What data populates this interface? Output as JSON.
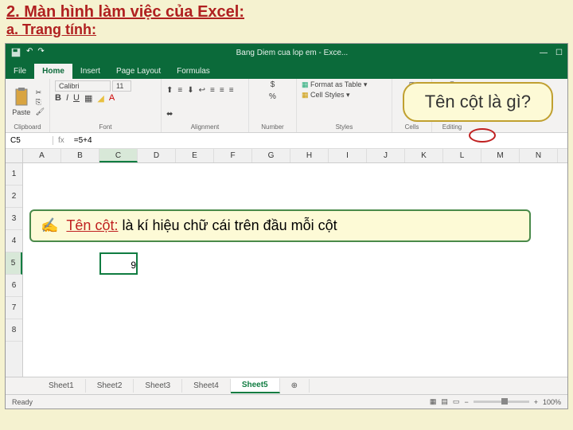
{
  "slide": {
    "title": "2. Màn hình làm việc của Excel:",
    "subtitle": "a. Trang tính:"
  },
  "titlebar": {
    "doc": "Bang Diem cua lop em - Exce..."
  },
  "tabs": {
    "file": "File",
    "home": "Home",
    "insert": "Insert",
    "page_layout": "Page Layout",
    "formulas": "Formulas"
  },
  "ribbon": {
    "paste": "Paste",
    "clipboard": "Clipboard",
    "font_name": "Calibri",
    "font_size": "11",
    "font": "Font",
    "alignment": "Alignment",
    "number": "Number",
    "format_table": "Format as Table",
    "cell_styles": "Cell Styles",
    "styles": "Styles",
    "cells": "Cells",
    "editing": "Editing"
  },
  "callout": {
    "question": "Tên cột là gì?"
  },
  "formula": {
    "namebox": "C5",
    "value": "=5+4"
  },
  "columns": [
    "A",
    "B",
    "C",
    "D",
    "E",
    "F",
    "G",
    "H",
    "I",
    "J",
    "K",
    "L",
    "M",
    "N"
  ],
  "rows": [
    "1",
    "2",
    "3",
    "4",
    "5",
    "6",
    "7",
    "8"
  ],
  "cell_value": "9",
  "answer": {
    "icon": "✍",
    "term": "Tên cột:",
    "rest": " là kí hiệu chữ cái trên đầu mỗi cột"
  },
  "sheets": {
    "s1": "Sheet1",
    "s2": "Sheet2",
    "s3": "Sheet3",
    "s4": "Sheet4",
    "s5": "Sheet5",
    "plus": "⊕"
  },
  "status": {
    "ready": "Ready",
    "zoom": "100%"
  }
}
